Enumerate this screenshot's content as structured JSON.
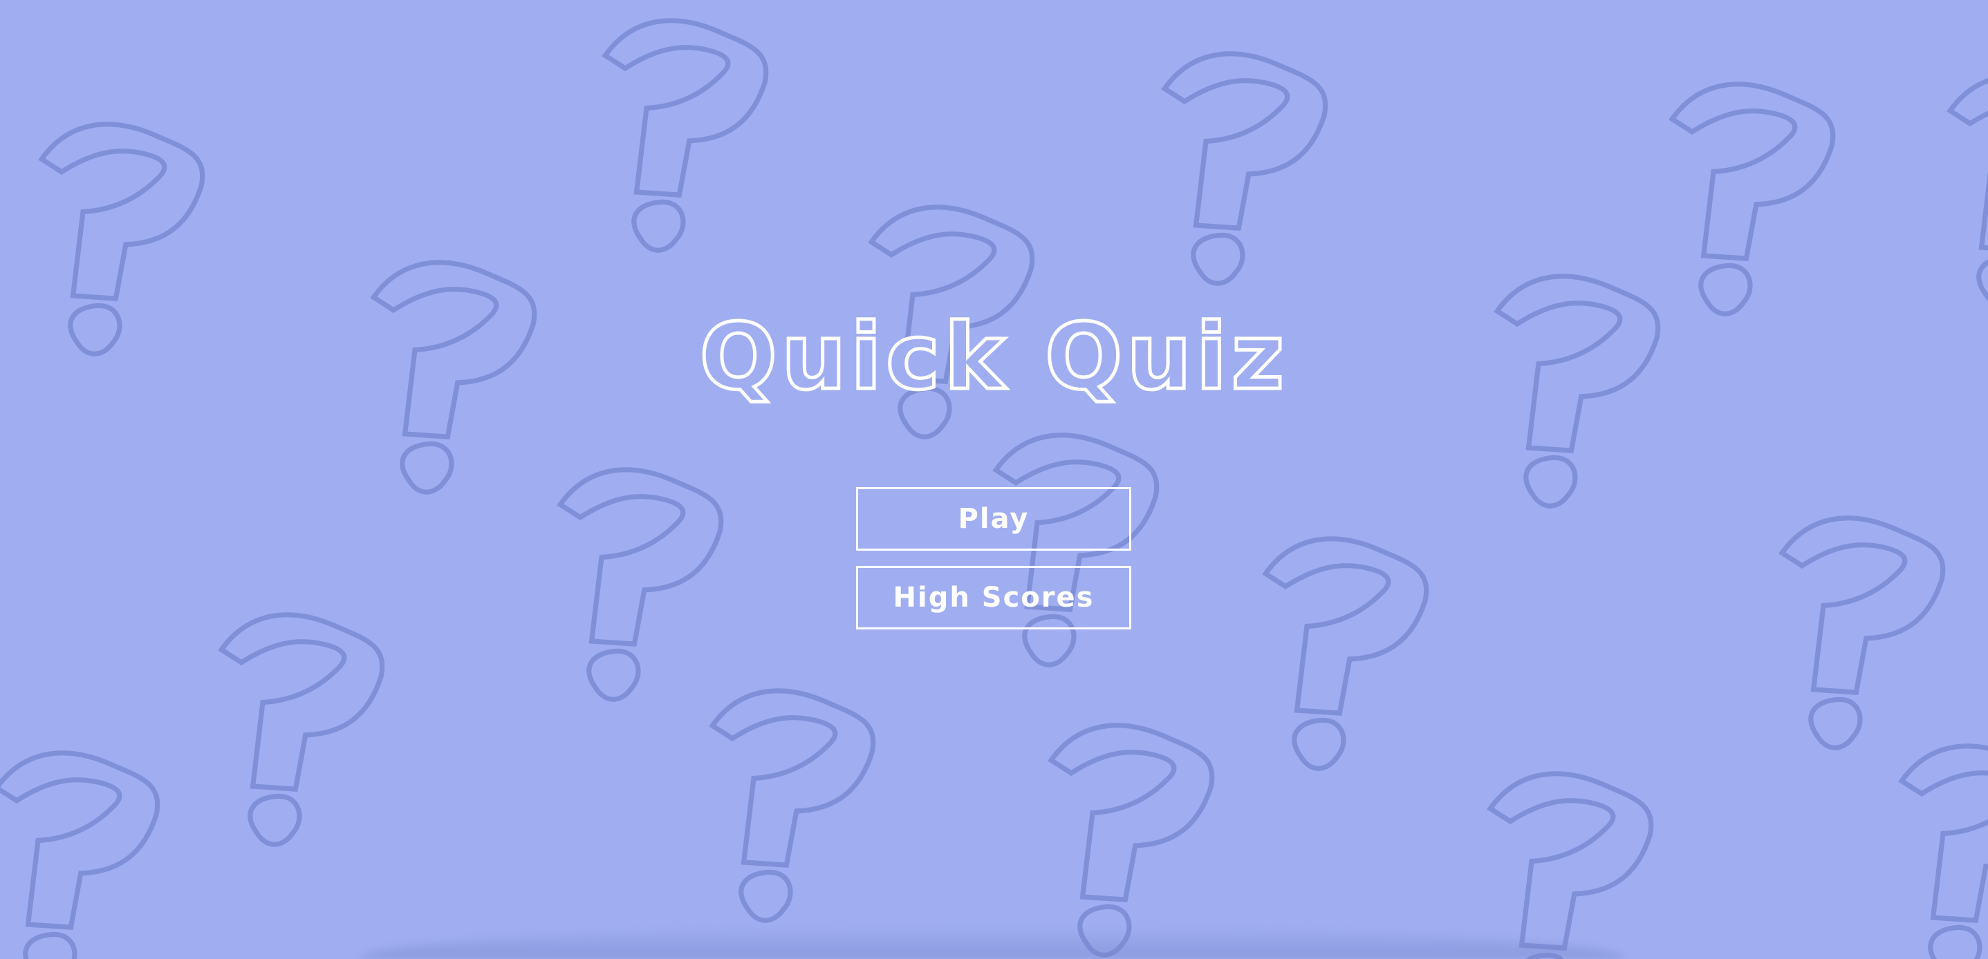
{
  "app": {
    "title": "Quick Quiz"
  },
  "menu": {
    "play_label": "Play",
    "high_scores_label": "High Scores"
  },
  "theme": {
    "background": "#a0aef1",
    "pattern_stroke": "#7f90d8",
    "text": "#ffffff"
  },
  "background_pattern": {
    "icon": "question-mark-icon"
  }
}
